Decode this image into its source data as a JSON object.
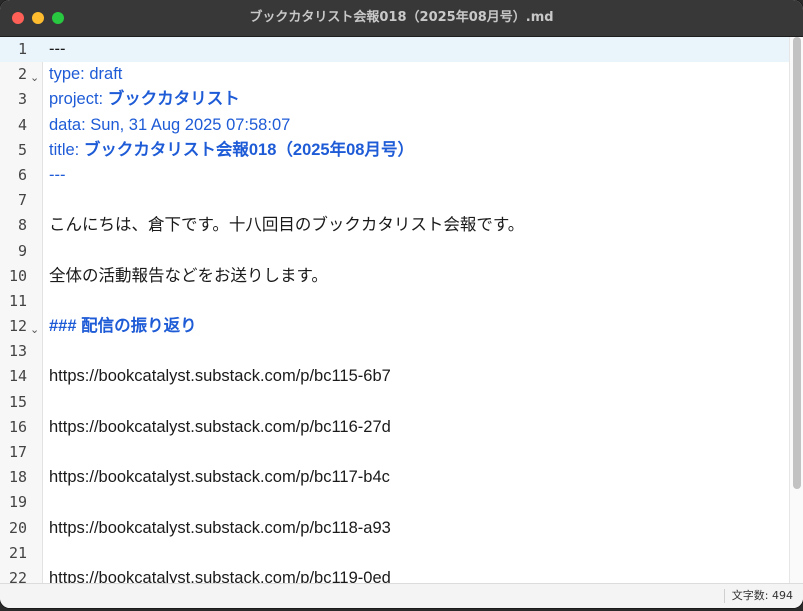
{
  "window": {
    "title": "ブックカタリスト会報018（2025年08月号）.md"
  },
  "editor": {
    "lines": [
      {
        "n": "1",
        "text": "---",
        "style": "plain",
        "current": true
      },
      {
        "n": "2",
        "text": "type: draft",
        "style": "frontmatter",
        "fold": true
      },
      {
        "n": "3",
        "prefix": "project: ",
        "text": "ブックカタリスト",
        "style": "frontmatter-bold"
      },
      {
        "n": "4",
        "text": "data: Sun, 31 Aug 2025 07:58:07",
        "style": "frontmatter"
      },
      {
        "n": "5",
        "prefix": "title: ",
        "text": "ブックカタリスト会報018（2025年08月号）",
        "style": "frontmatter-bold"
      },
      {
        "n": "6",
        "text": "---",
        "style": "frontmatter"
      },
      {
        "n": "7",
        "text": "",
        "style": "plain"
      },
      {
        "n": "8",
        "text": "こんにちは、倉下です。十八回目のブックカタリスト会報です。",
        "style": "plain"
      },
      {
        "n": "9",
        "text": "",
        "style": "plain"
      },
      {
        "n": "10",
        "text": "全体の活動報告などをお送りします。",
        "style": "plain"
      },
      {
        "n": "11",
        "text": "",
        "style": "plain"
      },
      {
        "n": "12",
        "text": "### 配信の振り返り",
        "style": "heading",
        "fold": true
      },
      {
        "n": "13",
        "text": "",
        "style": "plain"
      },
      {
        "n": "14",
        "text": "https://bookcatalyst.substack.com/p/bc115-6b7",
        "style": "plain"
      },
      {
        "n": "15",
        "text": "",
        "style": "plain"
      },
      {
        "n": "16",
        "text": "https://bookcatalyst.substack.com/p/bc116-27d",
        "style": "plain"
      },
      {
        "n": "17",
        "text": "",
        "style": "plain"
      },
      {
        "n": "18",
        "text": "https://bookcatalyst.substack.com/p/bc117-b4c",
        "style": "plain"
      },
      {
        "n": "19",
        "text": "",
        "style": "plain"
      },
      {
        "n": "20",
        "text": "https://bookcatalyst.substack.com/p/bc118-a93",
        "style": "plain"
      },
      {
        "n": "21",
        "text": "",
        "style": "plain"
      },
      {
        "n": "22",
        "text": "https://bookcatalyst.substack.com/p/bc119-0ed",
        "style": "plain"
      }
    ]
  },
  "status": {
    "word_count_label": "文字数: 494"
  },
  "colors": {
    "frontmatter": "#1e5bd6",
    "current_line": "#eaf4fb",
    "titlebar": "#383838"
  }
}
